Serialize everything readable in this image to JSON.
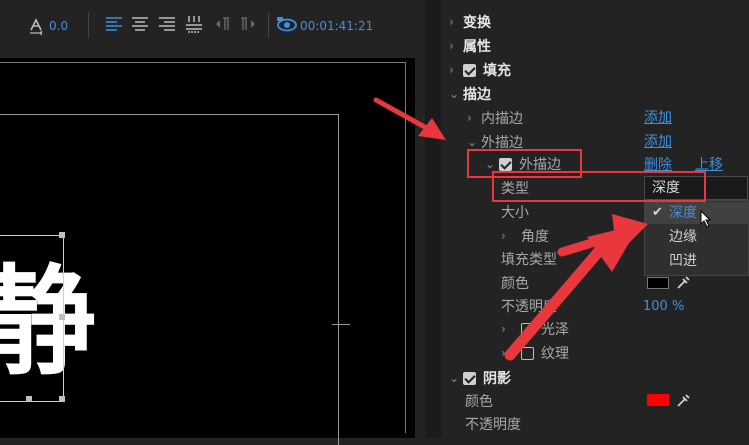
{
  "toolbar": {
    "tracking_value": "0.0",
    "timecode": "00:01:41:21"
  },
  "canvas": {
    "text_char": "静"
  },
  "panel": {
    "transform": "变换",
    "attributes": "属性",
    "fill": "填充",
    "stroke": "描边",
    "inner_stroke": "内描边",
    "outer_stroke": "外描边",
    "outer_stroke_item": "外描边",
    "add1": "添加",
    "add2": "添加",
    "delete": "删除",
    "move_up": "上移",
    "type_label": "类型",
    "size_label": "大小",
    "angle_label": "角度",
    "fill_type_label": "填充类型",
    "color_label": "颜色",
    "opacity_label": "不透明度",
    "opacity_value": "100 %",
    "sheen": "光泽",
    "texture": "纹理",
    "shadow": "阴影",
    "shadow_color_label": "颜色",
    "shadow_opacity_label": "不透明度"
  },
  "dropdown": {
    "selected": "深度",
    "options": [
      "深度",
      "边缘",
      "凹进"
    ]
  },
  "colors": {
    "accent": "#3d8fe0",
    "highlight_red": "#e8383d",
    "stroke_color": "#000000",
    "shadow_color": "#ff0000"
  }
}
